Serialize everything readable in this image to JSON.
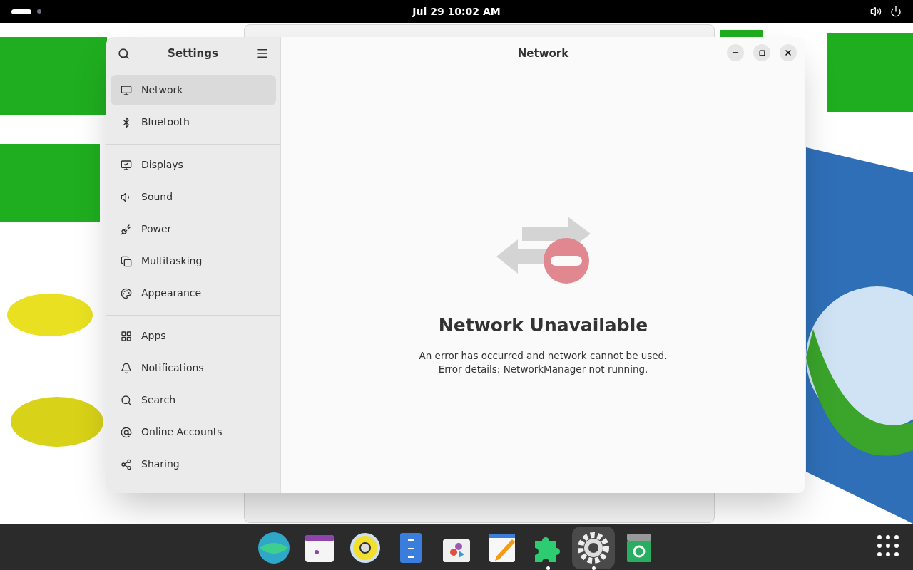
{
  "top_bar": {
    "clock": "Jul 29  10:02 AM"
  },
  "settings_window": {
    "sidebar_title": "Settings",
    "title": "Network",
    "sidebar": {
      "groups": [
        [
          {
            "label": "Network",
            "selected": true
          },
          {
            "label": "Bluetooth",
            "selected": false
          }
        ],
        [
          {
            "label": "Displays",
            "selected": false
          },
          {
            "label": "Sound",
            "selected": false
          },
          {
            "label": "Power",
            "selected": false
          },
          {
            "label": "Multitasking",
            "selected": false
          },
          {
            "label": "Appearance",
            "selected": false
          }
        ],
        [
          {
            "label": "Apps",
            "selected": false
          },
          {
            "label": "Notifications",
            "selected": false
          },
          {
            "label": "Search",
            "selected": false
          },
          {
            "label": "Online Accounts",
            "selected": false
          },
          {
            "label": "Sharing",
            "selected": false
          }
        ]
      ]
    },
    "status": {
      "heading": "Network Unavailable",
      "lines": [
        "An error has occurred and network cannot be used.",
        "Error details: NetworkManager not running."
      ]
    }
  },
  "dock": {
    "apps": [
      {
        "kind": "browser",
        "running": false,
        "selected": false
      },
      {
        "kind": "calendar",
        "running": false,
        "selected": false
      },
      {
        "kind": "music",
        "running": false,
        "selected": false
      },
      {
        "kind": "files",
        "running": false,
        "selected": false
      },
      {
        "kind": "software",
        "running": false,
        "selected": false
      },
      {
        "kind": "editor",
        "running": false,
        "selected": false
      },
      {
        "kind": "extensions",
        "running": true,
        "selected": false
      },
      {
        "kind": "settings",
        "running": true,
        "selected": true
      },
      {
        "kind": "trash",
        "running": false,
        "selected": false
      }
    ]
  }
}
